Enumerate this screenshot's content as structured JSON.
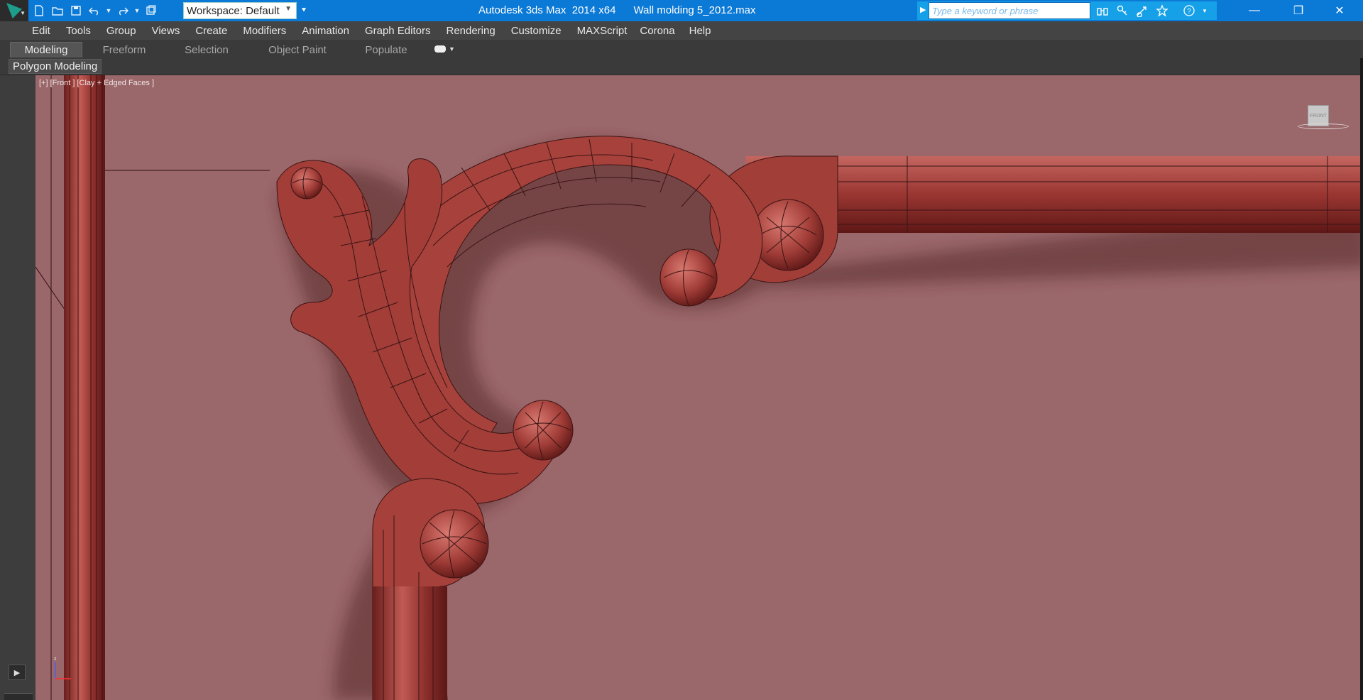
{
  "titlebar": {
    "app_title": "Autodesk 3ds Max  2014 x64      Wall molding 5_2012.max",
    "workspace": "Workspace: Default",
    "search_placeholder": "Type a keyword or phrase",
    "colors": {
      "titlebar": "#0b79d6",
      "search_area": "#16a0e8"
    },
    "quick_access_icons": [
      "new-file-icon",
      "open-folder-icon",
      "save-icon",
      "undo-icon",
      "redo-icon",
      "project-folder-icon"
    ],
    "search_icons": [
      "binoculars-icon",
      "key-icon",
      "exchange-icon",
      "star-icon",
      "help-icon"
    ],
    "window_buttons": [
      "minimize-icon",
      "restore-icon",
      "close-icon"
    ]
  },
  "menubar": {
    "items": [
      "Edit",
      "Tools",
      "Group",
      "Views",
      "Create",
      "Modifiers",
      "Animation",
      "Graph Editors",
      "Rendering",
      "Customize",
      "MAXScript",
      "Corona",
      "Help"
    ]
  },
  "ribbon": {
    "tabs": [
      {
        "label": "Modeling",
        "active": true
      },
      {
        "label": "Freeform",
        "active": false
      },
      {
        "label": "Selection",
        "active": false
      },
      {
        "label": "Object Paint",
        "active": false
      },
      {
        "label": "Populate",
        "active": false
      }
    ],
    "panel_label": "Polygon Modeling"
  },
  "viewport": {
    "label": "[+] [Front ] [Clay + Edged Faces ]",
    "viewcube_label": "FRONT",
    "colors": {
      "background": "#9a676a",
      "molding": "#9e3a36",
      "molding_light": "#c4605a",
      "wire": "#3a1414"
    }
  }
}
